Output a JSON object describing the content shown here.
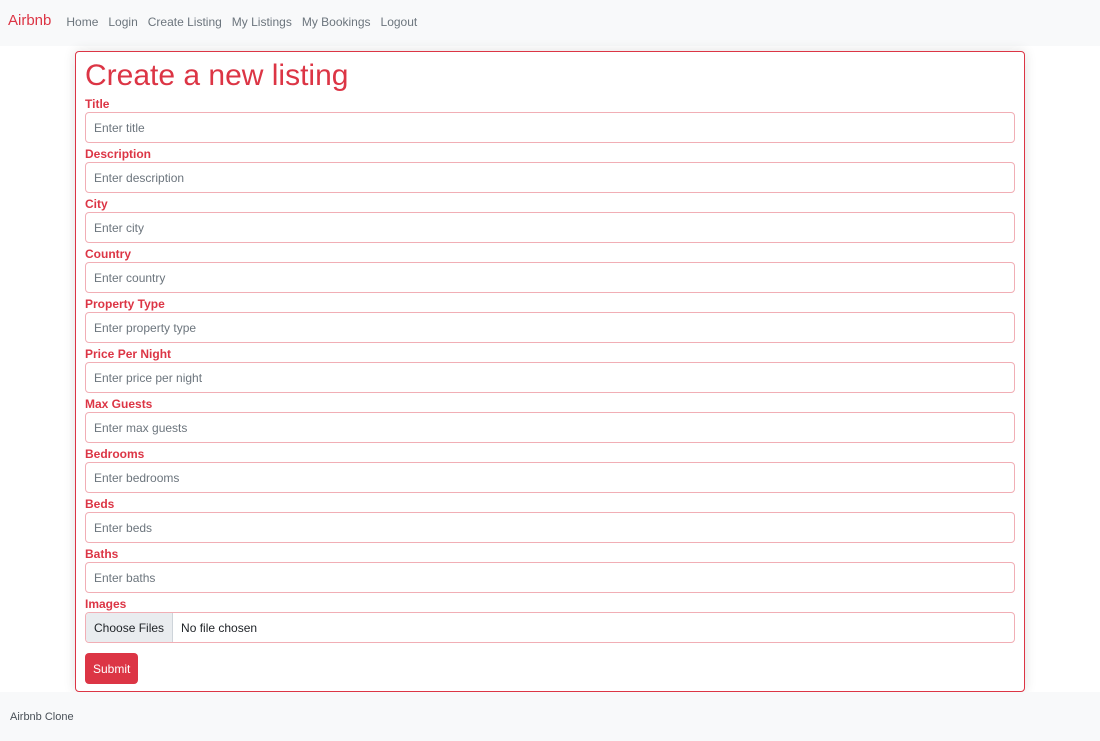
{
  "navbar": {
    "brand": "Airbnb",
    "links": [
      "Home",
      "Login",
      "Create Listing",
      "My Listings",
      "My Bookings",
      "Logout"
    ]
  },
  "form": {
    "title": "Create a new listing",
    "fields": [
      {
        "label": "Title",
        "placeholder": "Enter title",
        "value": ""
      },
      {
        "label": "Description",
        "placeholder": "Enter description",
        "value": ""
      },
      {
        "label": "City",
        "placeholder": "Enter city",
        "value": ""
      },
      {
        "label": "Country",
        "placeholder": "Enter country",
        "value": ""
      },
      {
        "label": "Property Type",
        "placeholder": "Enter property type",
        "value": ""
      },
      {
        "label": "Price Per Night",
        "placeholder": "Enter price per night",
        "value": ""
      },
      {
        "label": "Max Guests",
        "placeholder": "Enter max guests",
        "value": ""
      },
      {
        "label": "Bedrooms",
        "placeholder": "Enter bedrooms",
        "value": ""
      },
      {
        "label": "Beds",
        "placeholder": "Enter beds",
        "value": ""
      },
      {
        "label": "Baths",
        "placeholder": "Enter baths",
        "value": ""
      }
    ],
    "images": {
      "label": "Images",
      "button": "Choose Files",
      "status": "No file chosen"
    },
    "submit": "Submit"
  },
  "footer": {
    "text": "Airbnb Clone"
  },
  "colors": {
    "accent": "#dc3545",
    "navbar_bg": "#f8f9fa",
    "input_border": "#f1aeb5"
  }
}
